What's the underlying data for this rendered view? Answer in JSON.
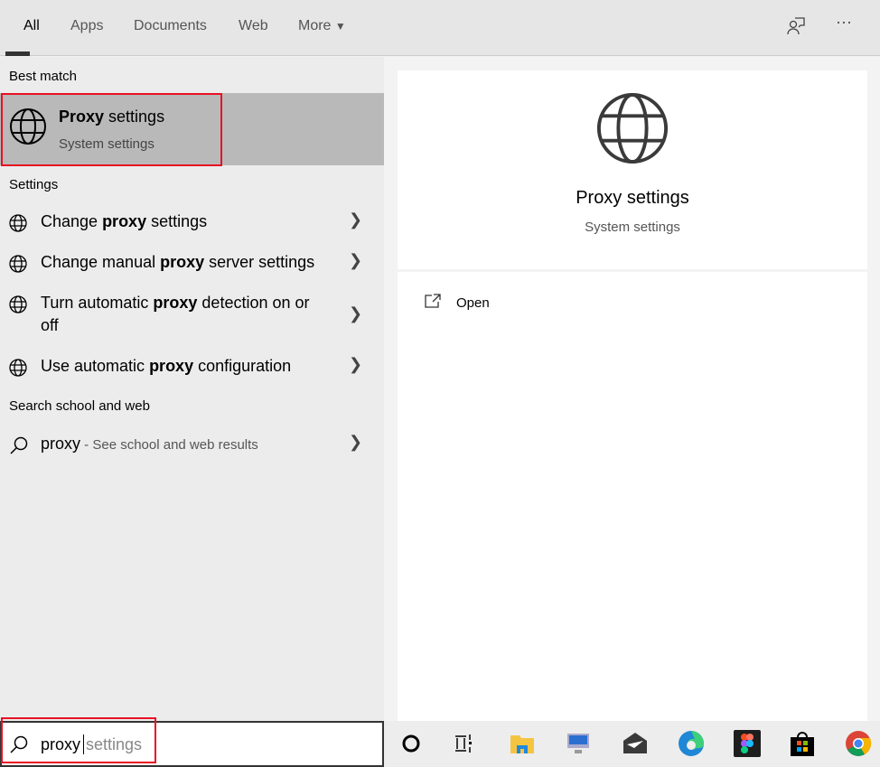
{
  "tabs": [
    "All",
    "Apps",
    "Documents",
    "Web",
    "More"
  ],
  "best_match": {
    "heading": "Best match",
    "title_bold": "Proxy",
    "title_rest": " settings",
    "subtitle": "System settings"
  },
  "settings": {
    "heading": "Settings",
    "items": [
      {
        "pre": "Change ",
        "bold": "proxy",
        "post": " settings"
      },
      {
        "pre": "Change manual ",
        "bold": "proxy",
        "post": " server settings"
      },
      {
        "pre": "Turn automatic ",
        "bold": "proxy",
        "post": " detection on or off"
      },
      {
        "pre": "Use automatic ",
        "bold": "proxy",
        "post": " configuration"
      }
    ]
  },
  "web": {
    "heading": "Search school and web",
    "query": "proxy",
    "hint": " - See school and web results"
  },
  "preview": {
    "title": "Proxy settings",
    "subtitle": "System settings",
    "open_label": "Open"
  },
  "search": {
    "typed": "proxy",
    "suggestion": "settings"
  },
  "taskbar": [
    "cortana",
    "task-view",
    "file-explorer",
    "remote-desktop",
    "mail",
    "edge",
    "figma",
    "store",
    "chrome"
  ],
  "colors": {
    "highlight": "#e81123",
    "selected": "#b9b9b9"
  }
}
